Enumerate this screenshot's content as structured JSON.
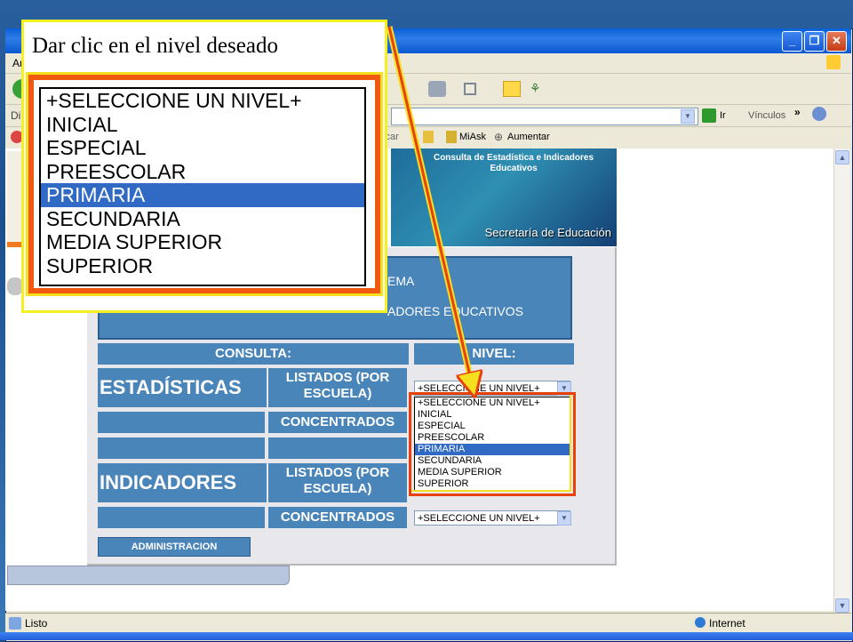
{
  "window": {
    "menu_letter": "Ar",
    "address_label": "Dir",
    "go_label": "Ir",
    "links_label": "Vínculos",
    "links_items": [
      "MiAsk",
      "Aumentar"
    ],
    "search_partial": "scar",
    "status_text": "Listo",
    "zone_text": "Internet"
  },
  "banner": {
    "title": "Consulta de Estadística e Indicadores Educativos",
    "secretaria": "Secretaría de Educación"
  },
  "info": {
    "line1": "EMA",
    "line2": "ADORES EDUCATIVOS"
  },
  "table": {
    "header_consulta": "CONSULTA:",
    "header_nivel": "NIVEL:",
    "estadisticas": "ESTADÍSTICAS",
    "indicadores": "INDICADORES",
    "listados": "LISTADOS (POR ESCUELA)",
    "concentrados": "CONCENTRADOS",
    "select_value": "+SELECCIONE UN NIVEL+",
    "admin_button": "ADMINISTRACION"
  },
  "levels": [
    "+SELECCIONE UN NIVEL+",
    "INICIAL",
    "ESPECIAL",
    "PREESCOLAR",
    "PRIMARIA",
    "SECUNDARIA",
    "MEDIA SUPERIOR",
    "SUPERIOR"
  ],
  "selected_level": "PRIMARIA",
  "callout": {
    "text": "Dar clic en el nivel deseado"
  },
  "colors": {
    "highlight_red": "#e8420c",
    "highlight_yellow": "#f5f020",
    "panel_blue": "#4a85ba",
    "selection_blue": "#316ac5"
  }
}
